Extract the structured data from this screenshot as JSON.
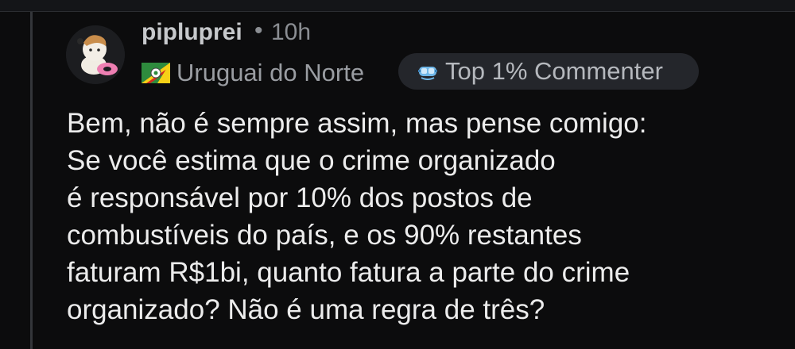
{
  "comment": {
    "author": "pipluprei",
    "separator": "•",
    "timestamp": "10h",
    "flair": {
      "icon": "rio-grande-do-sul-flag-icon",
      "text": "Uruguai do Norte"
    },
    "badge": {
      "icon": "diving-mask-icon",
      "text": "Top 1% Commenter"
    },
    "body_lines": [
      "Bem, não é sempre assim, mas pense comigo:",
      "Se você estima que o crime organizado",
      "é responsável por 10% dos postos de",
      "combustíveis do país, e os 90% restantes",
      "faturam R$1bi, quanto fatura a parte do crime",
      "organizado? Não é uma regra de três?"
    ]
  },
  "colors": {
    "background": "#0c0c0d",
    "thread_line": "#34363a",
    "username": "#c7c9cc",
    "meta": "#8b8e93",
    "badge_bg": "#24262b",
    "body_text": "#ececec"
  }
}
